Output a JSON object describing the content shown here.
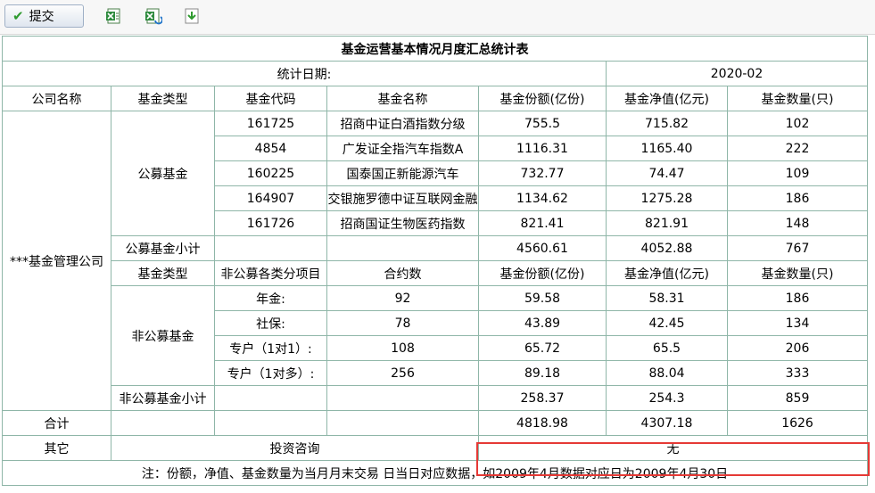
{
  "toolbar": {
    "submit_label": "提交",
    "icons": [
      "excel-export-icon",
      "excel-refresh-icon",
      "download-icon"
    ]
  },
  "report": {
    "title": "基金运营基本情况月度汇总统计表",
    "date_label": "统计日期:",
    "date_value": "2020-02",
    "headers": [
      "公司名称",
      "基金类型",
      "基金代码",
      "基金名称",
      "基金份额(亿份)",
      "基金净值(亿元)",
      "基金数量(只)"
    ],
    "company": "***基金管理公司",
    "public": {
      "type_label": "公募基金",
      "rows": [
        {
          "code": "161725",
          "name": "招商中证白酒指数分级",
          "shares": "755.5",
          "nav": "715.82",
          "count": "102"
        },
        {
          "code": "4854",
          "name": "广发证全指汽车指数A",
          "shares": "1116.31",
          "nav": "1165.40",
          "count": "222"
        },
        {
          "code": "160225",
          "name": "国泰国正新能源汽车",
          "shares": "732.77",
          "nav": "74.47",
          "count": "109"
        },
        {
          "code": "164907",
          "name": "交银施罗德中证互联网金融",
          "shares": "1134.62",
          "nav": "1275.28",
          "count": "186"
        },
        {
          "code": "161726",
          "name": "招商国证生物医药指数",
          "shares": "821.41",
          "nav": "821.91",
          "count": "148"
        }
      ],
      "subtotal": {
        "label": "公募基金小计",
        "shares": "4560.61",
        "nav": "4052.88",
        "count": "767"
      }
    },
    "nonpublic": {
      "headers": [
        "基金类型",
        "非公募各类分项目",
        "合约数",
        "基金份额(亿份)",
        "基金净值(亿元)",
        "基金数量(只)"
      ],
      "type_label": "非公募基金",
      "rows": [
        {
          "item": "年金:",
          "contracts": "92",
          "shares": "59.58",
          "nav": "58.31",
          "count": "186"
        },
        {
          "item": "社保:",
          "contracts": "78",
          "shares": "43.89",
          "nav": "42.45",
          "count": "134"
        },
        {
          "item": "专户（1对1）:",
          "contracts": "108",
          "shares": "65.72",
          "nav": "65.5",
          "count": "206"
        },
        {
          "item": "专户（1对多）:",
          "contracts": "256",
          "shares": "89.18",
          "nav": "88.04",
          "count": "333"
        }
      ],
      "subtotal": {
        "label": "非公募基金小计",
        "shares": "258.37",
        "nav": "254.3",
        "count": "859"
      }
    },
    "total": {
      "label": "合计",
      "shares": "4818.98",
      "nav": "4307.18",
      "count": "1626"
    },
    "other": {
      "label": "其它",
      "advisory_label": "投资咨询",
      "advisory_value": "无"
    },
    "note": "注：份额，净值、基金数量为当月月末交易 日当日对应数据，如2009年4月数据对应日为2009年4月30日"
  },
  "colors": {
    "header_green": "#d9f5ea",
    "subtotal_violet": "#dcdcff",
    "total_yellow": "#ffffc6",
    "highlight_red": "#e53935"
  }
}
